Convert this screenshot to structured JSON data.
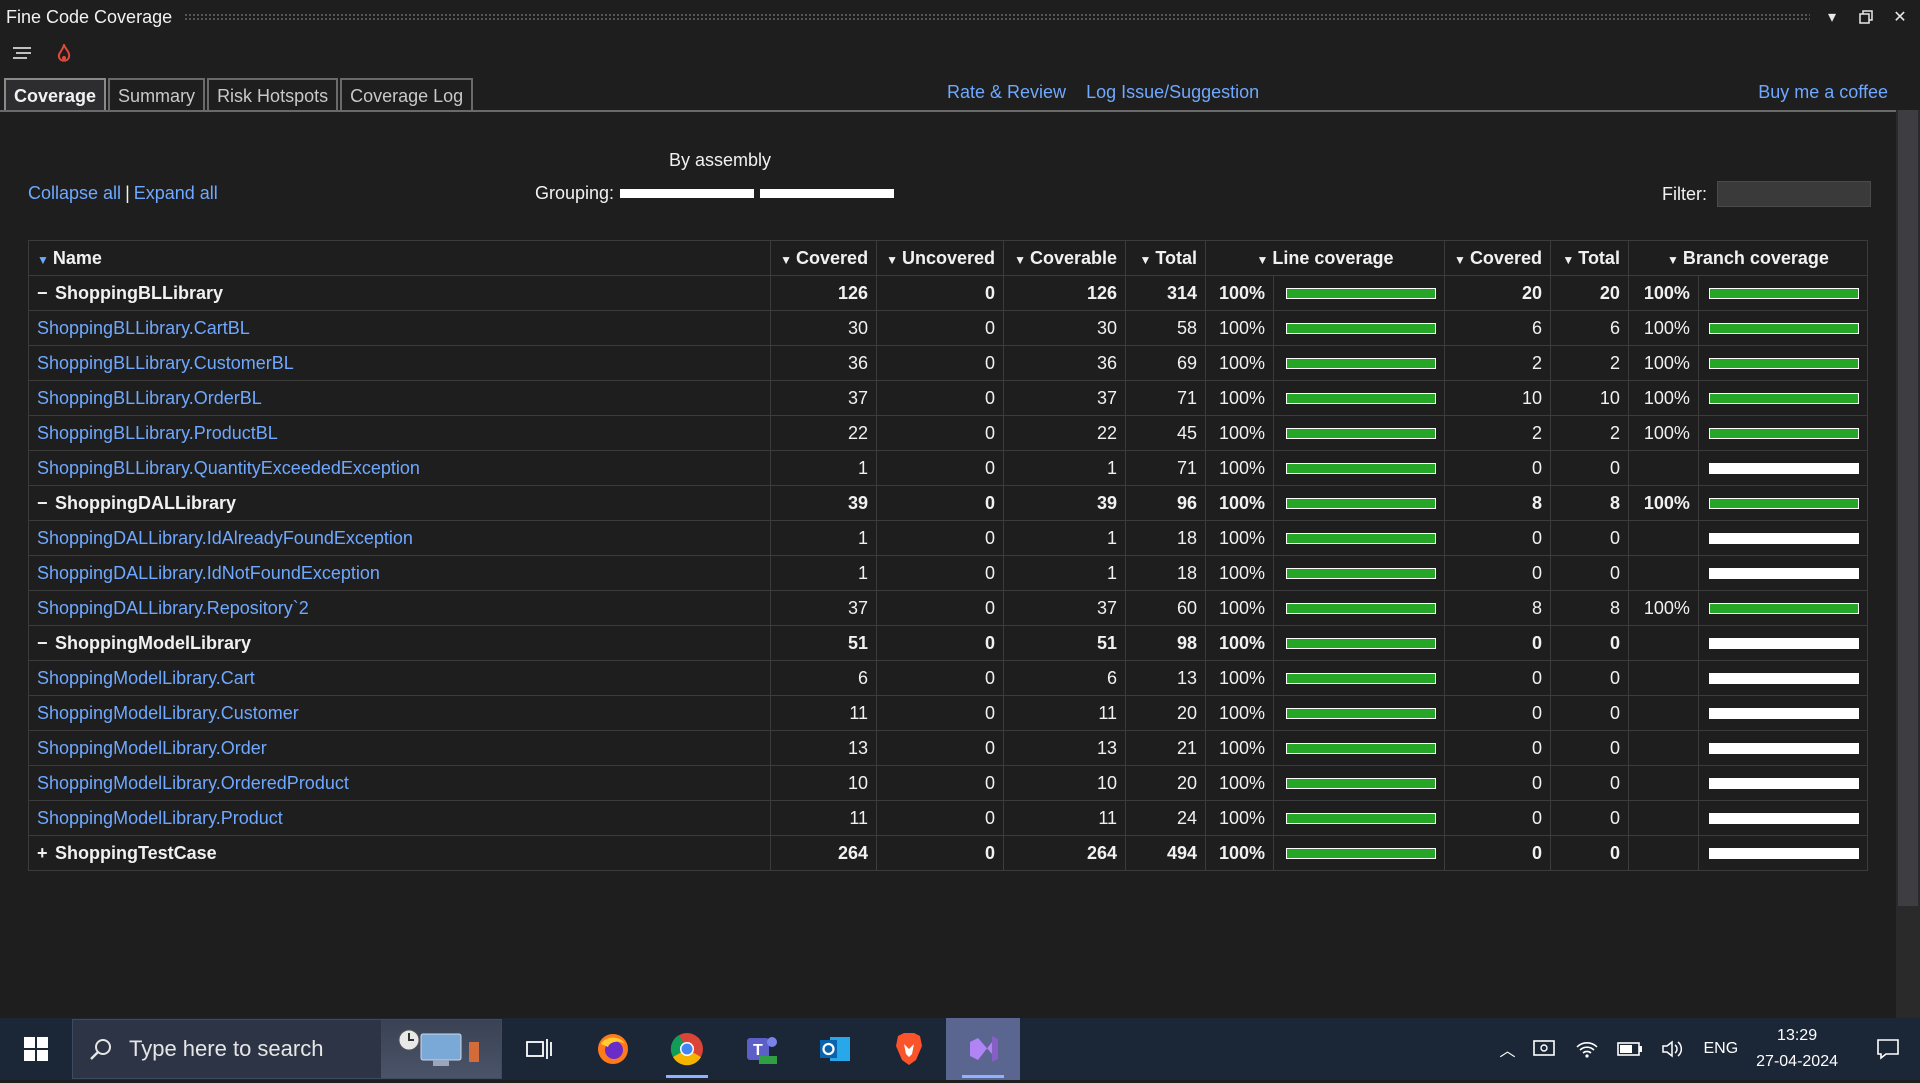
{
  "window": {
    "title": "Fine Code Coverage"
  },
  "tabs": [
    {
      "label": "Coverage",
      "active": true
    },
    {
      "label": "Summary",
      "active": false
    },
    {
      "label": "Risk Hotspots",
      "active": false
    },
    {
      "label": "Coverage Log",
      "active": false
    }
  ],
  "top_links": {
    "rate_review": "Rate & Review",
    "log_issue": "Log Issue/Suggestion",
    "coffee": "Buy me a coffee"
  },
  "controls": {
    "collapse_all": "Collapse all",
    "separator": "|",
    "expand_all": "Expand all",
    "grouping_value": "By assembly",
    "grouping_label": "Grouping:",
    "filter_label": "Filter:",
    "filter_value": ""
  },
  "table": {
    "headers": {
      "name": "Name",
      "covered": "Covered",
      "uncovered": "Uncovered",
      "coverable": "Coverable",
      "total": "Total",
      "line_coverage": "Line coverage",
      "branch_covered": "Covered",
      "branch_total": "Total",
      "branch_coverage": "Branch coverage"
    },
    "rows": [
      {
        "type": "assembly",
        "toggle": "−",
        "name": "ShoppingBLLibrary",
        "covered": "126",
        "uncovered": "0",
        "coverable": "126",
        "total": "314",
        "line_pct": "100%",
        "line_fill": 1,
        "b_covered": "20",
        "b_total": "20",
        "branch_pct": "100%",
        "branch_fill": 1
      },
      {
        "type": "class",
        "name": "ShoppingBLLibrary.CartBL",
        "covered": "30",
        "uncovered": "0",
        "coverable": "30",
        "total": "58",
        "line_pct": "100%",
        "line_fill": 1,
        "b_covered": "6",
        "b_total": "6",
        "branch_pct": "100%",
        "branch_fill": 1
      },
      {
        "type": "class",
        "name": "ShoppingBLLibrary.CustomerBL",
        "covered": "36",
        "uncovered": "0",
        "coverable": "36",
        "total": "69",
        "line_pct": "100%",
        "line_fill": 1,
        "b_covered": "2",
        "b_total": "2",
        "branch_pct": "100%",
        "branch_fill": 1
      },
      {
        "type": "class",
        "name": "ShoppingBLLibrary.OrderBL",
        "covered": "37",
        "uncovered": "0",
        "coverable": "37",
        "total": "71",
        "line_pct": "100%",
        "line_fill": 1,
        "b_covered": "10",
        "b_total": "10",
        "branch_pct": "100%",
        "branch_fill": 1
      },
      {
        "type": "class",
        "name": "ShoppingBLLibrary.ProductBL",
        "covered": "22",
        "uncovered": "0",
        "coverable": "22",
        "total": "45",
        "line_pct": "100%",
        "line_fill": 1,
        "b_covered": "2",
        "b_total": "2",
        "branch_pct": "100%",
        "branch_fill": 1
      },
      {
        "type": "class",
        "name": "ShoppingBLLibrary.QuantityExceededException",
        "covered": "1",
        "uncovered": "0",
        "coverable": "1",
        "total": "71",
        "line_pct": "100%",
        "line_fill": 1,
        "b_covered": "0",
        "b_total": "0",
        "branch_pct": "",
        "branch_fill": 0
      },
      {
        "type": "assembly",
        "toggle": "−",
        "name": "ShoppingDALLibrary",
        "covered": "39",
        "uncovered": "0",
        "coverable": "39",
        "total": "96",
        "line_pct": "100%",
        "line_fill": 1,
        "b_covered": "8",
        "b_total": "8",
        "branch_pct": "100%",
        "branch_fill": 1
      },
      {
        "type": "class",
        "name": "ShoppingDALLibrary.IdAlreadyFoundException",
        "covered": "1",
        "uncovered": "0",
        "coverable": "1",
        "total": "18",
        "line_pct": "100%",
        "line_fill": 1,
        "b_covered": "0",
        "b_total": "0",
        "branch_pct": "",
        "branch_fill": 0
      },
      {
        "type": "class",
        "name": "ShoppingDALLibrary.IdNotFoundException",
        "covered": "1",
        "uncovered": "0",
        "coverable": "1",
        "total": "18",
        "line_pct": "100%",
        "line_fill": 1,
        "b_covered": "0",
        "b_total": "0",
        "branch_pct": "",
        "branch_fill": 0
      },
      {
        "type": "class",
        "name": "ShoppingDALLibrary.Repository`2",
        "covered": "37",
        "uncovered": "0",
        "coverable": "37",
        "total": "60",
        "line_pct": "100%",
        "line_fill": 1,
        "b_covered": "8",
        "b_total": "8",
        "branch_pct": "100%",
        "branch_fill": 1
      },
      {
        "type": "assembly",
        "toggle": "−",
        "name": "ShoppingModelLibrary",
        "covered": "51",
        "uncovered": "0",
        "coverable": "51",
        "total": "98",
        "line_pct": "100%",
        "line_fill": 1,
        "b_covered": "0",
        "b_total": "0",
        "branch_pct": "",
        "branch_fill": 0
      },
      {
        "type": "class",
        "name": "ShoppingModelLibrary.Cart",
        "covered": "6",
        "uncovered": "0",
        "coverable": "6",
        "total": "13",
        "line_pct": "100%",
        "line_fill": 1,
        "b_covered": "0",
        "b_total": "0",
        "branch_pct": "",
        "branch_fill": 0
      },
      {
        "type": "class",
        "name": "ShoppingModelLibrary.Customer",
        "covered": "11",
        "uncovered": "0",
        "coverable": "11",
        "total": "20",
        "line_pct": "100%",
        "line_fill": 1,
        "b_covered": "0",
        "b_total": "0",
        "branch_pct": "",
        "branch_fill": 0
      },
      {
        "type": "class",
        "name": "ShoppingModelLibrary.Order",
        "covered": "13",
        "uncovered": "0",
        "coverable": "13",
        "total": "21",
        "line_pct": "100%",
        "line_fill": 1,
        "b_covered": "0",
        "b_total": "0",
        "branch_pct": "",
        "branch_fill": 0
      },
      {
        "type": "class",
        "name": "ShoppingModelLibrary.OrderedProduct",
        "covered": "10",
        "uncovered": "0",
        "coverable": "10",
        "total": "20",
        "line_pct": "100%",
        "line_fill": 1,
        "b_covered": "0",
        "b_total": "0",
        "branch_pct": "",
        "branch_fill": 0
      },
      {
        "type": "class",
        "name": "ShoppingModelLibrary.Product",
        "covered": "11",
        "uncovered": "0",
        "coverable": "11",
        "total": "24",
        "line_pct": "100%",
        "line_fill": 1,
        "b_covered": "0",
        "b_total": "0",
        "branch_pct": "",
        "branch_fill": 0
      },
      {
        "type": "assembly",
        "toggle": "+",
        "name": "ShoppingTestCase",
        "covered": "264",
        "uncovered": "0",
        "coverable": "264",
        "total": "494",
        "line_pct": "100%",
        "line_fill": 1,
        "b_covered": "0",
        "b_total": "0",
        "branch_pct": "",
        "branch_fill": 0
      }
    ]
  },
  "taskbar": {
    "search_placeholder": "Type here to search",
    "apps": [
      "task-view",
      "firefox",
      "chrome",
      "teams",
      "outlook",
      "brave",
      "visual-studio"
    ],
    "language": "ENG",
    "time": "13:29",
    "date": "27-04-2024"
  },
  "colors": {
    "link": "#6fa8ff",
    "bar_fill": "#26a626",
    "background": "#1e1e1e"
  }
}
